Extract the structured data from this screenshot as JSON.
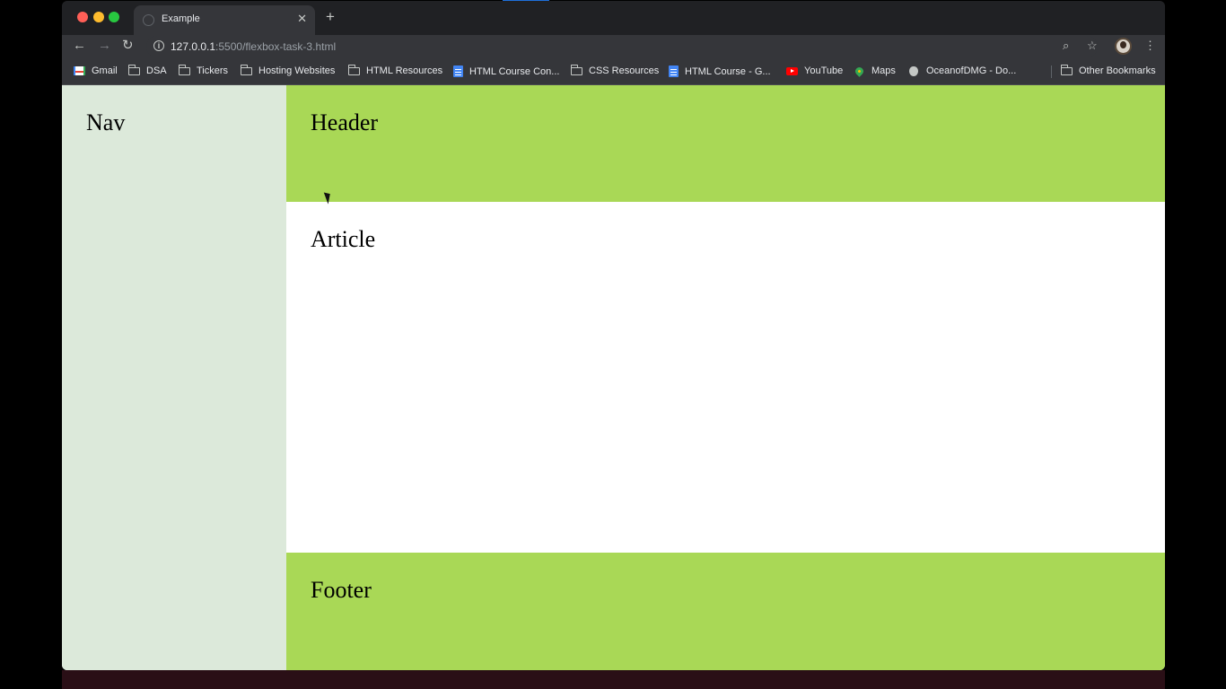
{
  "browser": {
    "tab": {
      "title": "Example",
      "close_icon": "close-icon"
    },
    "new_tab_label": "+",
    "toolbar": {
      "back_icon": "←",
      "forward_icon": "→",
      "reload_icon": "↻",
      "url_host": "127.0.0.1",
      "url_rest": ":5500/flexbox-task-3.html",
      "zoom_icon": "⌕",
      "star_icon": "☆",
      "menu_icon": "⋮"
    },
    "bookmarks": [
      {
        "label": "Gmail",
        "icon": "gmail-icon"
      },
      {
        "label": "DSA",
        "icon": "folder-icon"
      },
      {
        "label": "Tickers",
        "icon": "folder-icon"
      },
      {
        "label": "Hosting Websites",
        "icon": "folder-icon"
      },
      {
        "label": "HTML Resources",
        "icon": "folder-icon"
      },
      {
        "label": "HTML Course Con...",
        "icon": "doc-icon"
      },
      {
        "label": "CSS Resources",
        "icon": "folder-icon"
      },
      {
        "label": "HTML Course - G...",
        "icon": "doc-icon"
      },
      {
        "label": "YouTube",
        "icon": "youtube-icon"
      },
      {
        "label": "Maps",
        "icon": "maps-icon"
      },
      {
        "label": "OceanofDMG - Do...",
        "icon": "apple-icon"
      },
      {
        "label": "Other Bookmarks",
        "icon": "folder-icon"
      }
    ]
  },
  "page": {
    "nav": {
      "title": "Nav"
    },
    "header": {
      "title": "Header"
    },
    "article": {
      "title": "Article"
    },
    "footer": {
      "title": "Footer"
    }
  },
  "colors": {
    "nav_bg": "#dce9da",
    "header_bg": "#a9d856",
    "article_bg": "#ffffff",
    "footer_bg": "#a9d856"
  }
}
